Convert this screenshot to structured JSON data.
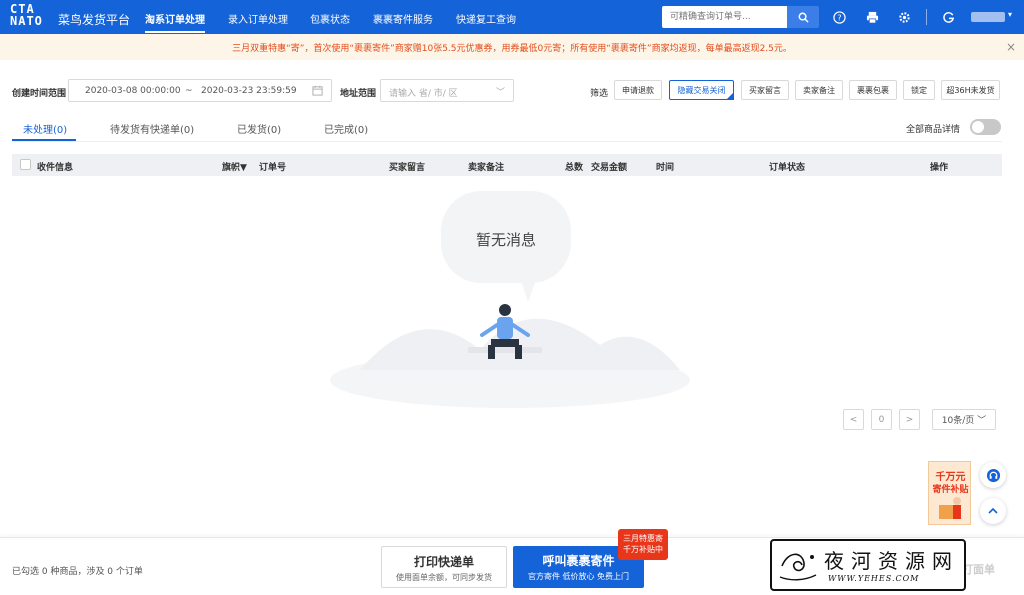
{
  "header": {
    "logo_line1": "CTA",
    "logo_line2": "NATO",
    "brand": "菜鸟发货平台",
    "nav": [
      "淘系订单处理",
      "录入订单处理",
      "包裹状态",
      "裹裹寄件服务",
      "快递复工查询"
    ],
    "search_placeholder": "可精确查询订单号..."
  },
  "notice": {
    "text": "三月双重特惠“寄”，首次使用“裹裹寄件”商家赠10张5.5元优惠券，用券最低0元寄；所有使用“裹裹寄件”商家均返现，每单最高返现2.5元。"
  },
  "filters": {
    "time_label": "创建时间范围",
    "start": "2020-03-08 00:00:00",
    "sep": "~",
    "end": "2020-03-23 23:59:59",
    "addr_label": "地址范围",
    "addr_placeholder": "请输入 省/ 市/ 区",
    "screen_label": "筛选",
    "buttons": [
      "申请退款",
      "隐藏交易关闭",
      "买家留言",
      "卖家备注",
      "裹裹包裹",
      "锁定",
      "超36H未发货"
    ]
  },
  "tabs": [
    "未处理(0)",
    "待发货有快递单(0)",
    "已发货(0)",
    "已完成(0)"
  ],
  "toggle_label": "全部商品详情",
  "table": {
    "headers": [
      "收件信息",
      "旗帜▼",
      "订单号",
      "买家留言",
      "卖家备注",
      "总数",
      "交易金额",
      "时间",
      "订单状态",
      "操作"
    ]
  },
  "empty": "暂无消息",
  "pagination": {
    "prev": "<",
    "page": "0",
    "next": ">",
    "size": "10条/页"
  },
  "promo": {
    "line1": "千万元",
    "line2": "寄件补贴"
  },
  "bottom": {
    "selection_info": "已勾选 0 种商品，涉及 0 个订单",
    "print_title": "打印快递单",
    "print_sub": "使用面单余额，可同步发货",
    "call_title": "呼叫裹裹寄件",
    "call_sub": "官方寄件 低价放心 免费上门",
    "badge_line1": "三月特惠寄",
    "badge_line2": "千万补贴中",
    "right_btn": "打面单"
  },
  "watermark": {
    "cn": "夜河资源网",
    "url": "WWW.YEHES.COM"
  },
  "colors": {
    "brand": "#1463d8",
    "notice_text": "#e54c1b",
    "badge": "#e8361b"
  }
}
